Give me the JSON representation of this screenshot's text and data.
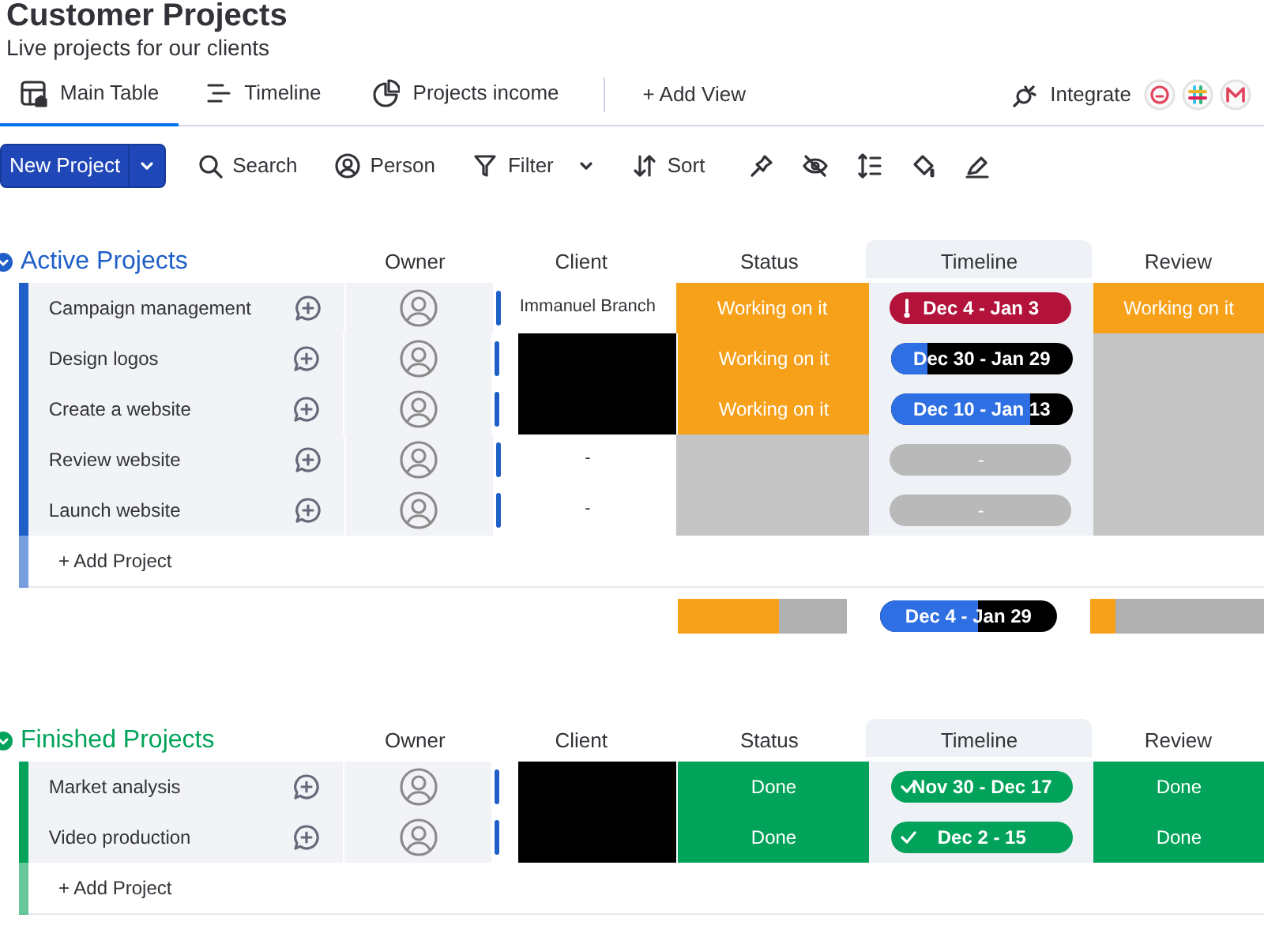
{
  "title": "Customer Projects",
  "subtitle": "Live projects for our clients",
  "tabs": [
    {
      "label": "Main Table",
      "selected": true
    },
    {
      "label": "Timeline",
      "selected": false
    },
    {
      "label": "Projects income",
      "selected": false
    }
  ],
  "add_view": "+ Add View",
  "integrate": "Integrate",
  "toolbar": {
    "new_button": "New Project",
    "tools": [
      {
        "label": "Search",
        "dropdown": false
      },
      {
        "label": "Person",
        "dropdown": false
      },
      {
        "label": "Filter",
        "dropdown": true
      },
      {
        "label": "Sort",
        "dropdown": false
      }
    ]
  },
  "groups": [
    {
      "title": "Active Projects",
      "color": "#1f5fc8",
      "columns": [
        "Owner",
        "Client",
        "Status",
        "Timeline",
        "Review"
      ],
      "rows": [
        {
          "name": "Campaign management",
          "client": {
            "kind": "text",
            "text": "Immanuel Branch"
          },
          "status": {
            "kind": "working",
            "label": "Working on it"
          },
          "timeline": {
            "kind": "overdue",
            "text": "Dec 4 - Jan 3"
          },
          "review": {
            "kind": "working",
            "label": "Working on it"
          }
        },
        {
          "name": "Design logos",
          "client": {
            "kind": "redacted"
          },
          "status": {
            "kind": "working",
            "label": "Working on it"
          },
          "timeline": {
            "kind": "progress",
            "text": "Dec 30 - Jan 29",
            "level": 0.2
          },
          "review": {
            "kind": "empty"
          }
        },
        {
          "name": "Create a website",
          "client": {
            "kind": "redacted"
          },
          "status": {
            "kind": "working",
            "label": "Working on it"
          },
          "timeline": {
            "kind": "progress",
            "text": "Dec 10 - Jan 13",
            "level": 0.77
          },
          "review": {
            "kind": "empty"
          }
        },
        {
          "name": "Review website",
          "client": {
            "kind": "text",
            "text": "-"
          },
          "status": {
            "kind": "empty"
          },
          "timeline": {
            "kind": "empty",
            "text": "-"
          },
          "review": {
            "kind": "empty"
          }
        },
        {
          "name": "Launch website",
          "client": {
            "kind": "text",
            "text": "-"
          },
          "status": {
            "kind": "empty"
          },
          "timeline": {
            "kind": "empty",
            "text": "-"
          },
          "review": {
            "kind": "empty"
          }
        }
      ],
      "add_label": "+ Add Project",
      "summary": {
        "status": {
          "level": 0.6
        },
        "timeline": {
          "text": "Dec 4 - Jan 29",
          "level": 0.55
        },
        "review": {
          "level": 0.15
        }
      }
    },
    {
      "title": "Finished Projects",
      "color": "#00a359",
      "columns": [
        "Owner",
        "Client",
        "Status",
        "Timeline",
        "Review"
      ],
      "rows": [
        {
          "name": "Market analysis",
          "client": {
            "kind": "redacted"
          },
          "status": {
            "kind": "done",
            "label": "Done"
          },
          "timeline": {
            "kind": "done",
            "text": "Nov 30 - Dec 17"
          },
          "review": {
            "kind": "done",
            "label": "Done"
          }
        },
        {
          "name": "Video production",
          "client": {
            "kind": "redacted"
          },
          "status": {
            "kind": "done",
            "label": "Done"
          },
          "timeline": {
            "kind": "done",
            "text": "Dec 2 - 15"
          },
          "review": {
            "kind": "done",
            "label": "Done"
          }
        }
      ],
      "add_label": "+ Add Project"
    }
  ]
}
